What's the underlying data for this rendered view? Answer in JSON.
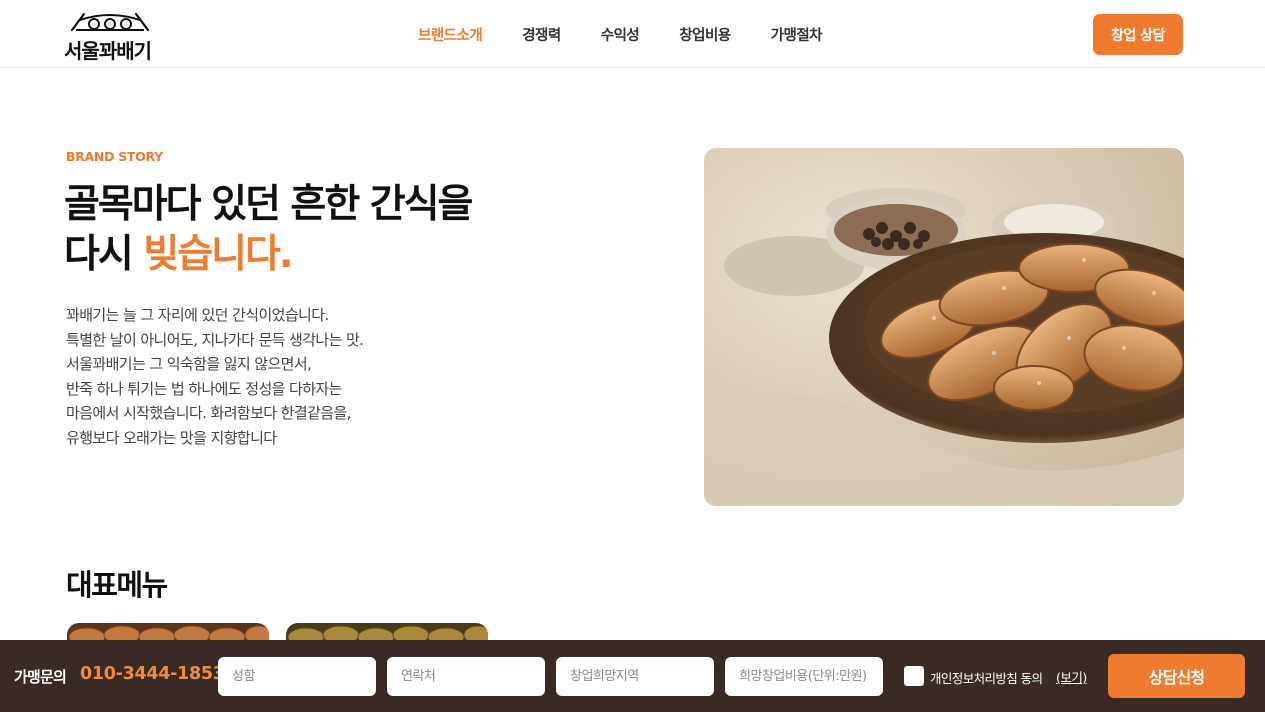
{
  "header": {
    "logo_text": "서울꽈배기",
    "nav": [
      {
        "label": "브랜드소개",
        "active": true
      },
      {
        "label": "경쟁력",
        "active": false
      },
      {
        "label": "수익성",
        "active": false
      },
      {
        "label": "창업비용",
        "active": false
      },
      {
        "label": "가맹절차",
        "active": false
      }
    ],
    "cta_label": "창업 상담"
  },
  "hero": {
    "eyebrow": "BRAND STORY",
    "headline_line1": "골목마다 있던 흔한 간식을",
    "headline_line2_prefix": "다시 ",
    "headline_line2_accent": "빚습니다.",
    "description": [
      "꽈배기는 늘 그 자리에 있던 간식이었습니다.",
      "특별한 날이 아니어도, 지나가다 문득 생각나는 맛.",
      "서울꽈배기는 그 익숙함을 잃지 않으면서,",
      "반죽 하나 튀기는 법 하나에도 정성을 다하자는",
      "마음에서 시작했습니다. 화려함보다 한결같음을,",
      "유행보다 오래가는 맛을 지향합니다"
    ]
  },
  "menu_section": {
    "title": "대표메뉴"
  },
  "inquiry_bar": {
    "label": "가맹문의",
    "phone": "010-3444-1853",
    "fields": [
      {
        "placeholder": "성함"
      },
      {
        "placeholder": "연락처"
      },
      {
        "placeholder": "창업희망지역"
      },
      {
        "placeholder": "희망창업비용(단위:만원)"
      }
    ],
    "agree_text": "개인정보처리방침 동의",
    "agree_view": "(보기)",
    "agree_checked": false,
    "submit_label": "상담신청"
  },
  "colors": {
    "accent": "#ef7b2f",
    "bar_bg": "#3a2a25"
  }
}
